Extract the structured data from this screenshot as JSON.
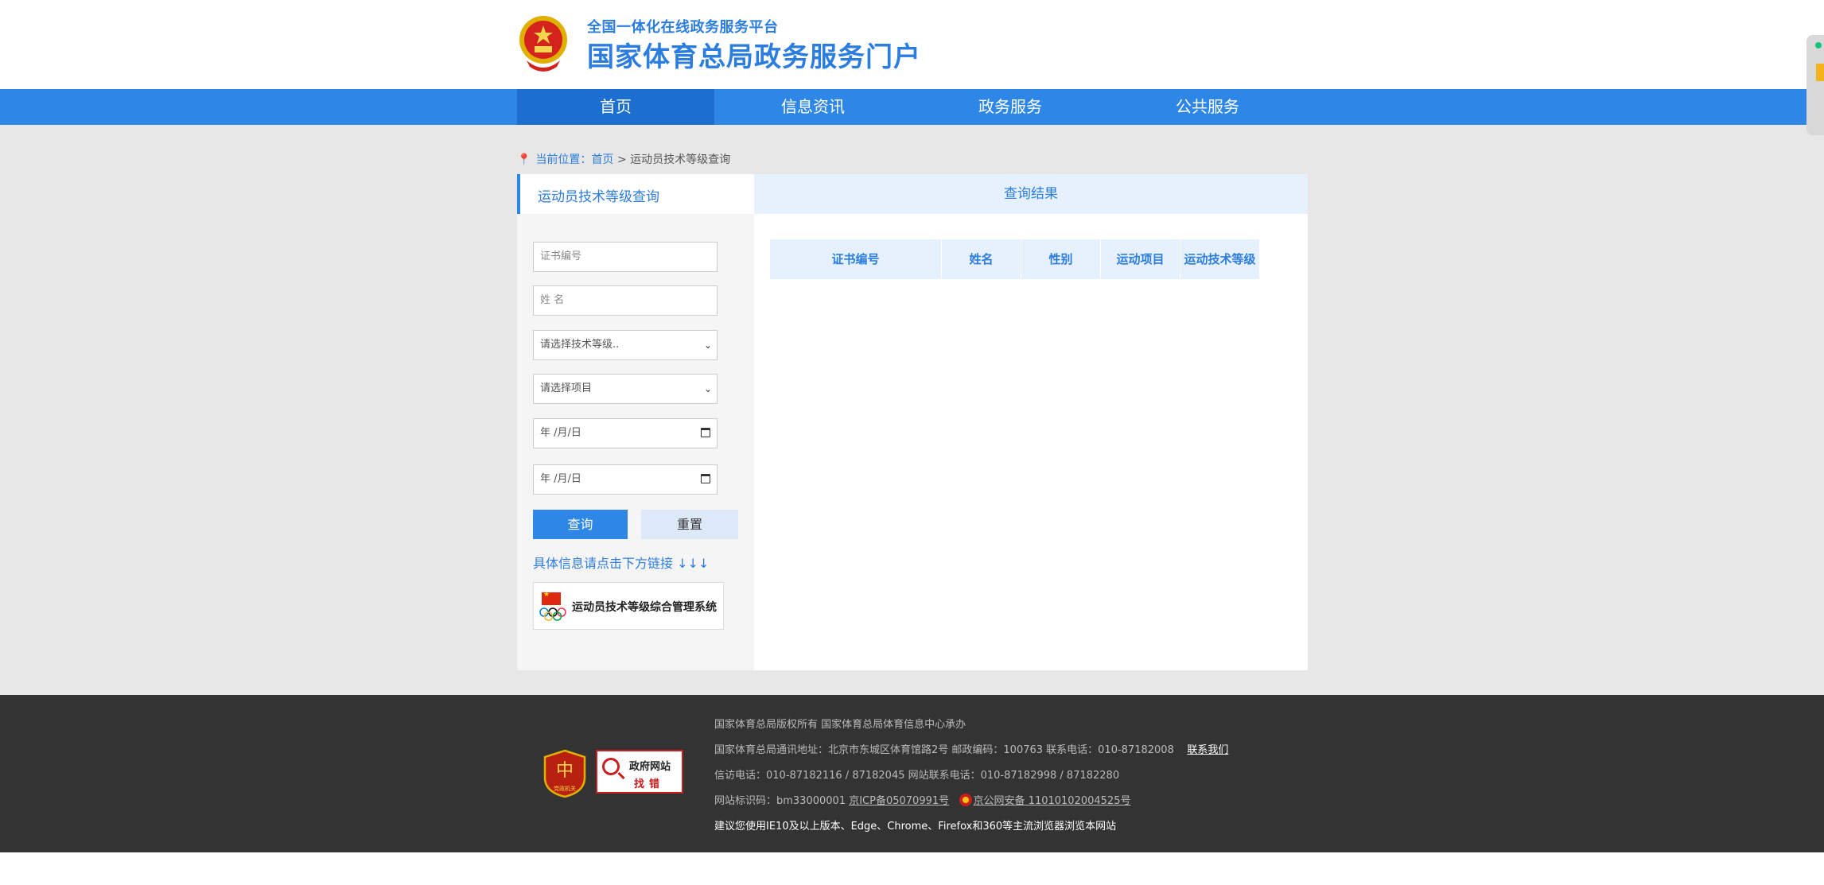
{
  "header": {
    "sub_title": "全国一体化在线政务服务平台",
    "main_title": "国家体育总局政务服务门户"
  },
  "nav": {
    "items": [
      {
        "label": "首页"
      },
      {
        "label": "信息资讯"
      },
      {
        "label": "政务服务"
      },
      {
        "label": "公共服务"
      }
    ]
  },
  "breadcrumb": {
    "prefix": "当前位置：",
    "home": "首页",
    "sep": " > ",
    "current": "运动员技术等级查询"
  },
  "left_panel": {
    "tab_label": "运动员技术等级查询",
    "cert_placeholder": "证书编号",
    "name_placeholder": "姓 名",
    "level_select": "请选择技术等级..",
    "project_select": "请选择项目",
    "date_from": "年 /月/日",
    "date_to": "年 /月/日",
    "query_label": "查询",
    "reset_label": "重置",
    "hint": "具体信息请点击下方链接 ↓↓↓",
    "system_link": "运动员技术等级综合管理系统"
  },
  "results": {
    "tab_label": "查询结果",
    "columns": [
      "证书编号",
      "姓名",
      "性别",
      "运动项目",
      "运动技术等级"
    ]
  },
  "footer": {
    "badge_label": "党政机关",
    "gov_badge_top": "政府网站",
    "gov_badge_bottom": "找错",
    "line1": "国家体育总局版权所有    国家体育总局体育信息中心承办",
    "line2_text": "国家体育总局通讯地址：北京市东城区体育馆路2号    邮政编码：100763    联系电话：010-87182008",
    "line2_link": "联系我们",
    "line3": "信访电话：010-87182116 / 87182045    网站联系电话：010-87182998 / 87182280",
    "line4_prefix": "网站标识码：bm33000001 ",
    "line4_icp": "京ICP备05070991号",
    "line4_police": "京公网安备 11010102004525号",
    "line5": "建议您使用IE10及以上版本、Edge、Chrome、Firefox和360等主流浏览器浏览本网站"
  },
  "colors": {
    "primary": "#2e86e6",
    "primary_dark": "#1c6fd1",
    "footer_bg": "#333333",
    "body_gray": "#e7e7e7"
  }
}
